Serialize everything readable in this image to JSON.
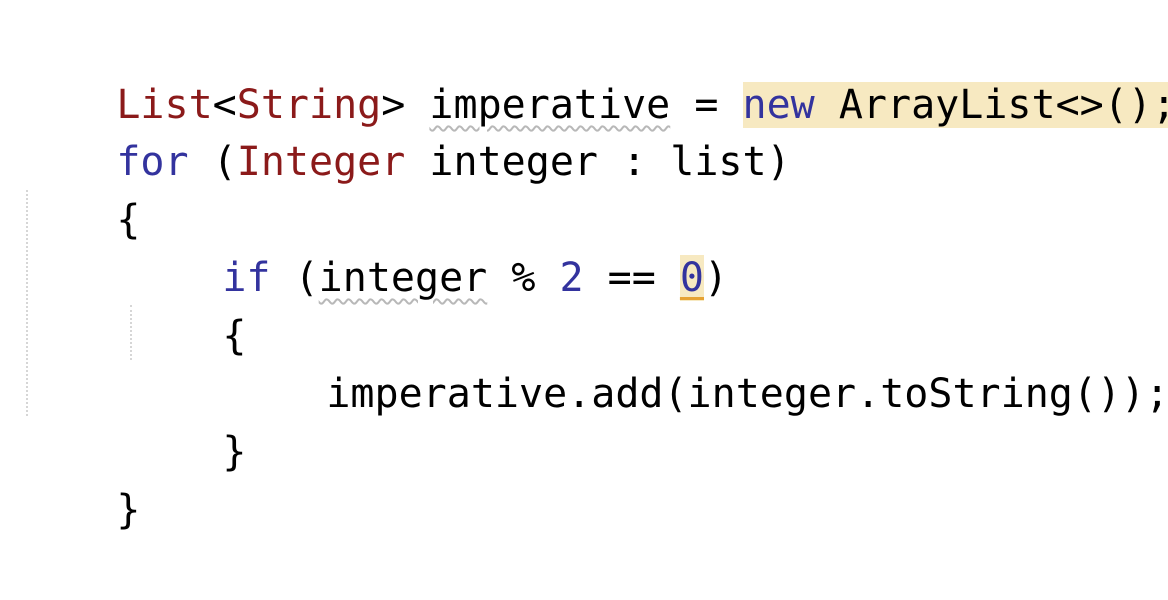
{
  "editor": {
    "language": "Java",
    "colors": {
      "keyword": "#33339e",
      "type": "#8b1a1a",
      "number": "#33339e",
      "highlight": "#f7e9c1",
      "warning_underline": "#e6a233",
      "squiggle": "#b8b8b8"
    },
    "lines": [
      {
        "type_list": "List",
        "lt": "<",
        "type_string": "String",
        "gt": "> ",
        "var": "imperative",
        "eq": " = ",
        "kw_new": "new",
        "ctor": " ArrayList<>();"
      },
      {
        "kw_for": "for",
        "open": " (",
        "type_integer": "Integer",
        "rest": " integer : list)"
      },
      {
        "brace": "{"
      },
      {
        "kw_if": "if",
        "open": " (",
        "var": "integer",
        "mid": " % ",
        "num2": "2",
        "eq": " == ",
        "num0": "0",
        "close": ")"
      },
      {
        "brace": "{"
      },
      {
        "code": "imperative.add(integer.toString());"
      },
      {
        "brace": "}"
      },
      {
        "brace": "}"
      }
    ]
  }
}
